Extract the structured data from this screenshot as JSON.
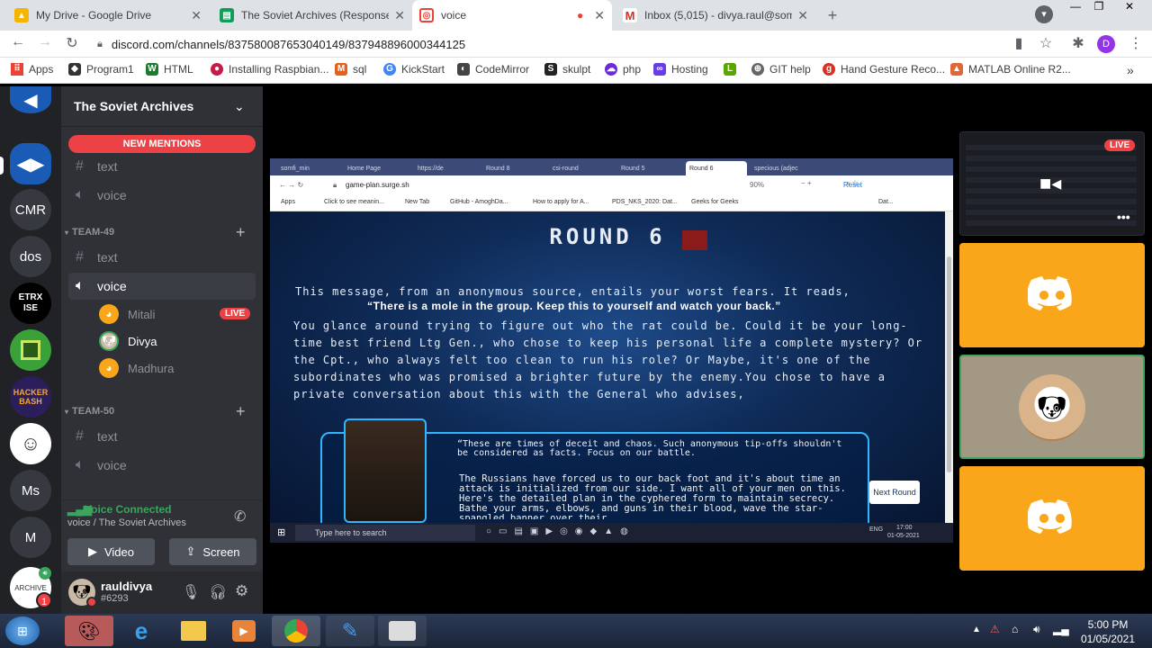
{
  "browser": {
    "tabs": [
      {
        "title": "My Drive - Google Drive",
        "icon": "google-drive-icon",
        "color": "#f4b400"
      },
      {
        "title": "The Soviet Archives (Responses)",
        "icon": "google-sheets-icon",
        "color": "#0f9d58"
      },
      {
        "title": "voice",
        "icon": "discord-icon",
        "color": "#ea4335"
      },
      {
        "title": "Inbox (5,015) - divya.raul@soma",
        "icon": "gmail-icon",
        "color": "#d93025"
      }
    ],
    "url": "discord.com/channels/837580087653040149/837948896000344125",
    "profile_initial": "D",
    "bookmarks": [
      {
        "label": "Apps",
        "icon": "apps-grid-icon"
      },
      {
        "label": "Program1",
        "icon": "program-icon"
      },
      {
        "label": "HTML",
        "icon": "html-icon"
      },
      {
        "label": "Installing Raspbian...",
        "icon": "raspberry-icon"
      },
      {
        "label": "sql",
        "icon": "sql-icon"
      },
      {
        "label": "KickStart",
        "icon": "google-icon"
      },
      {
        "label": "CodeMirror",
        "icon": "codemirror-icon"
      },
      {
        "label": "skulpt",
        "icon": "skulpt-icon"
      },
      {
        "label": "php",
        "icon": "php-icon"
      },
      {
        "label": "Hosting",
        "icon": "hosting-icon"
      },
      {
        "label": "",
        "icon": "green-l-icon"
      },
      {
        "label": "GIT help",
        "icon": "git-icon"
      },
      {
        "label": "Hand Gesture Reco...",
        "icon": "g-red-icon"
      },
      {
        "label": "MATLAB Online R2...",
        "icon": "matlab-icon"
      }
    ]
  },
  "discord": {
    "server_name": "The Soviet Archives",
    "new_mentions": "NEW MENTIONS",
    "guild_texts": [
      "CMR",
      "dos",
      "ETRX ISE",
      "Ms",
      "M"
    ],
    "guild_badge": "1",
    "top_channels": [
      {
        "type": "text",
        "name": "text"
      },
      {
        "type": "voice",
        "name": "voice"
      }
    ],
    "categories": [
      {
        "name": "TEAM-49"
      },
      {
        "name": "TEAM-50"
      }
    ],
    "team49_channels": [
      {
        "type": "text",
        "name": "text"
      },
      {
        "type": "voice",
        "name": "voice"
      }
    ],
    "voice_users": [
      {
        "name": "Mitali",
        "live": "LIVE"
      },
      {
        "name": "Divya"
      },
      {
        "name": "Madhura"
      }
    ],
    "team50_channels": [
      {
        "type": "text",
        "name": "text"
      },
      {
        "type": "voice",
        "name": "voice"
      }
    ],
    "voice_status": "Voice Connected",
    "voice_location": "voice / The Soviet Archives",
    "video_label": "Video",
    "screen_label": "Screen",
    "username": "rauldivya",
    "discriminator": "#6293"
  },
  "share": {
    "tabs": [
      "somfi_min",
      "Home Page",
      "https://de",
      "Round 8",
      "csi-round",
      "Round 5",
      "Round 6",
      "specious (adjec"
    ],
    "url": "game-plan.surge.sh",
    "zoom": "90%",
    "reset": "Reset",
    "bookmarks": [
      "Apps",
      "Click to see meanin...",
      "New Tab",
      "GitHub - AmoghDa...",
      "How to apply for A...",
      "PDS_NKS_2020: Dat...",
      "Geeks for Geeks",
      "Dat..."
    ],
    "round_title": "ROUND 6",
    "message_line": "This message, from an anonymous source, entails your worst fears. It reads,",
    "quote": "“There is a mole in the group. Keep this to yourself and watch your back.”",
    "paragraph": "You glance around trying to figure out who the rat could be. Could it be your long-time best friend Ltg Gen., who chose to keep his personal life a complete mystery? Or the Cpt., who always felt too clean to run his role? Or Maybe, it's one of the subordinates who was promised a brighter future by the enemy.You chose to have a private conversation about this with the General who advises,",
    "general_quote_1": "“These are times of deceit and chaos. Such anonymous tip-offs shouldn't be considered as facts. Focus on our battle.",
    "general_quote_2": "The Russians have forced us to our back foot and it's about time an attack is initialized from our side. I want all of your men on this. Here's the detailed plan in the cyphered form to maintain secrecy. Bathe your arms, elbows, and guns in their blood, wave the star-spangled banner over their",
    "next_round": "Next Round",
    "search_placeholder": "Type here to search",
    "clock_time": "17:00",
    "clock_date": "01-05-2021",
    "lang": "ENG"
  },
  "stream": {
    "live": "LIVE"
  },
  "taskbar": {
    "time": "5:00 PM",
    "date": "01/05/2021"
  },
  "colors": {
    "discord_orange": "#faa61a",
    "live_red": "#ed4245",
    "voice_green": "#3ba55d"
  }
}
